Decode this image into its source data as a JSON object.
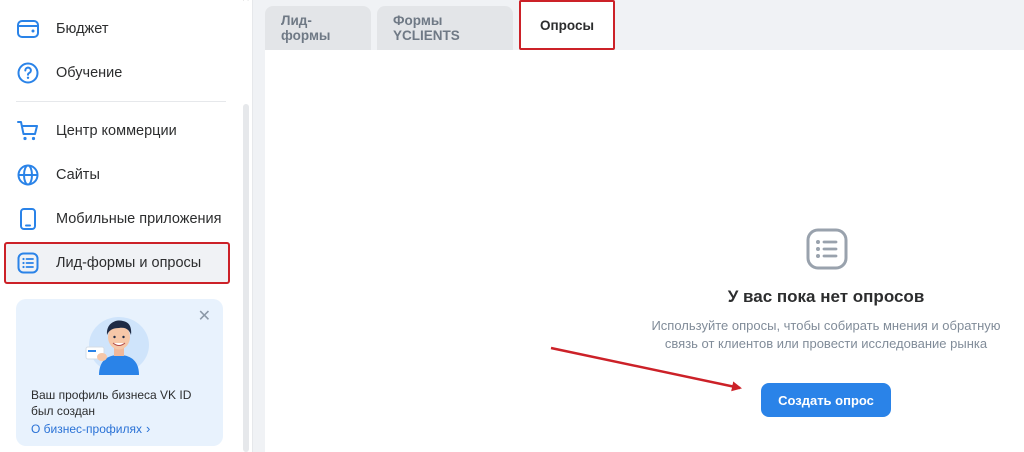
{
  "sidebar": {
    "items": [
      {
        "label": "Бюджет",
        "icon": "wallet-icon"
      },
      {
        "label": "Обучение",
        "icon": "question-circle-icon"
      },
      {
        "label": "Центр коммерции",
        "icon": "cart-icon"
      },
      {
        "label": "Сайты",
        "icon": "globe-icon"
      },
      {
        "label": "Мобильные приложения",
        "icon": "smartphone-icon"
      },
      {
        "label": "Лид-формы и опросы",
        "icon": "list-form-icon",
        "active": true
      }
    ],
    "promo": {
      "text": "Ваш профиль бизнеса VK ID был создан",
      "link": "О бизнес-профилях",
      "close_icon": "close-icon",
      "illustration": "person-with-card-illustration"
    }
  },
  "main": {
    "tabs": [
      {
        "label": "Лид-формы"
      },
      {
        "label": "Формы YCLIENTS"
      },
      {
        "label": "Опросы",
        "active": true
      }
    ],
    "empty_state": {
      "icon": "list-icon",
      "title": "У вас пока нет опросов",
      "description": "Используйте опросы, чтобы собирать мнения и обратную связь от клиентов или провести исследование рынка",
      "button_label": "Создать опрос"
    }
  },
  "colors": {
    "accent": "#2a83e8",
    "highlight": "#cc2128",
    "link": "#2a72d6",
    "background": "#f0f2f5"
  }
}
